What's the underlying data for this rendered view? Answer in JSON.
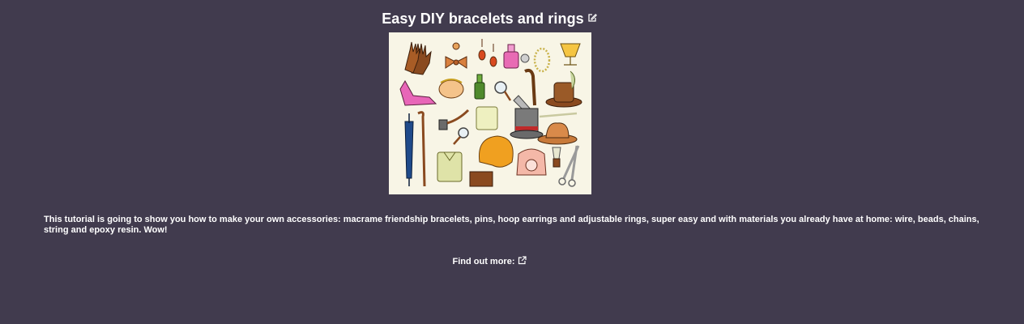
{
  "article": {
    "title": "Easy DIY bracelets and rings",
    "description": "This tutorial is going to show you how to make your own accessories: macrame friendship bracelets, pins, hoop earrings and adjustable rings, super easy and with materials you already have at home: wire, beads, chains, string and epoxy resin. Wow!",
    "find_out_more_label": "Find out more:"
  },
  "icons": {
    "edit": "edit-icon",
    "external_link": "external-link-icon"
  },
  "colors": {
    "background": "#413b4e",
    "text": "#ffffff",
    "illustration_bg": "#f8f5e6"
  }
}
